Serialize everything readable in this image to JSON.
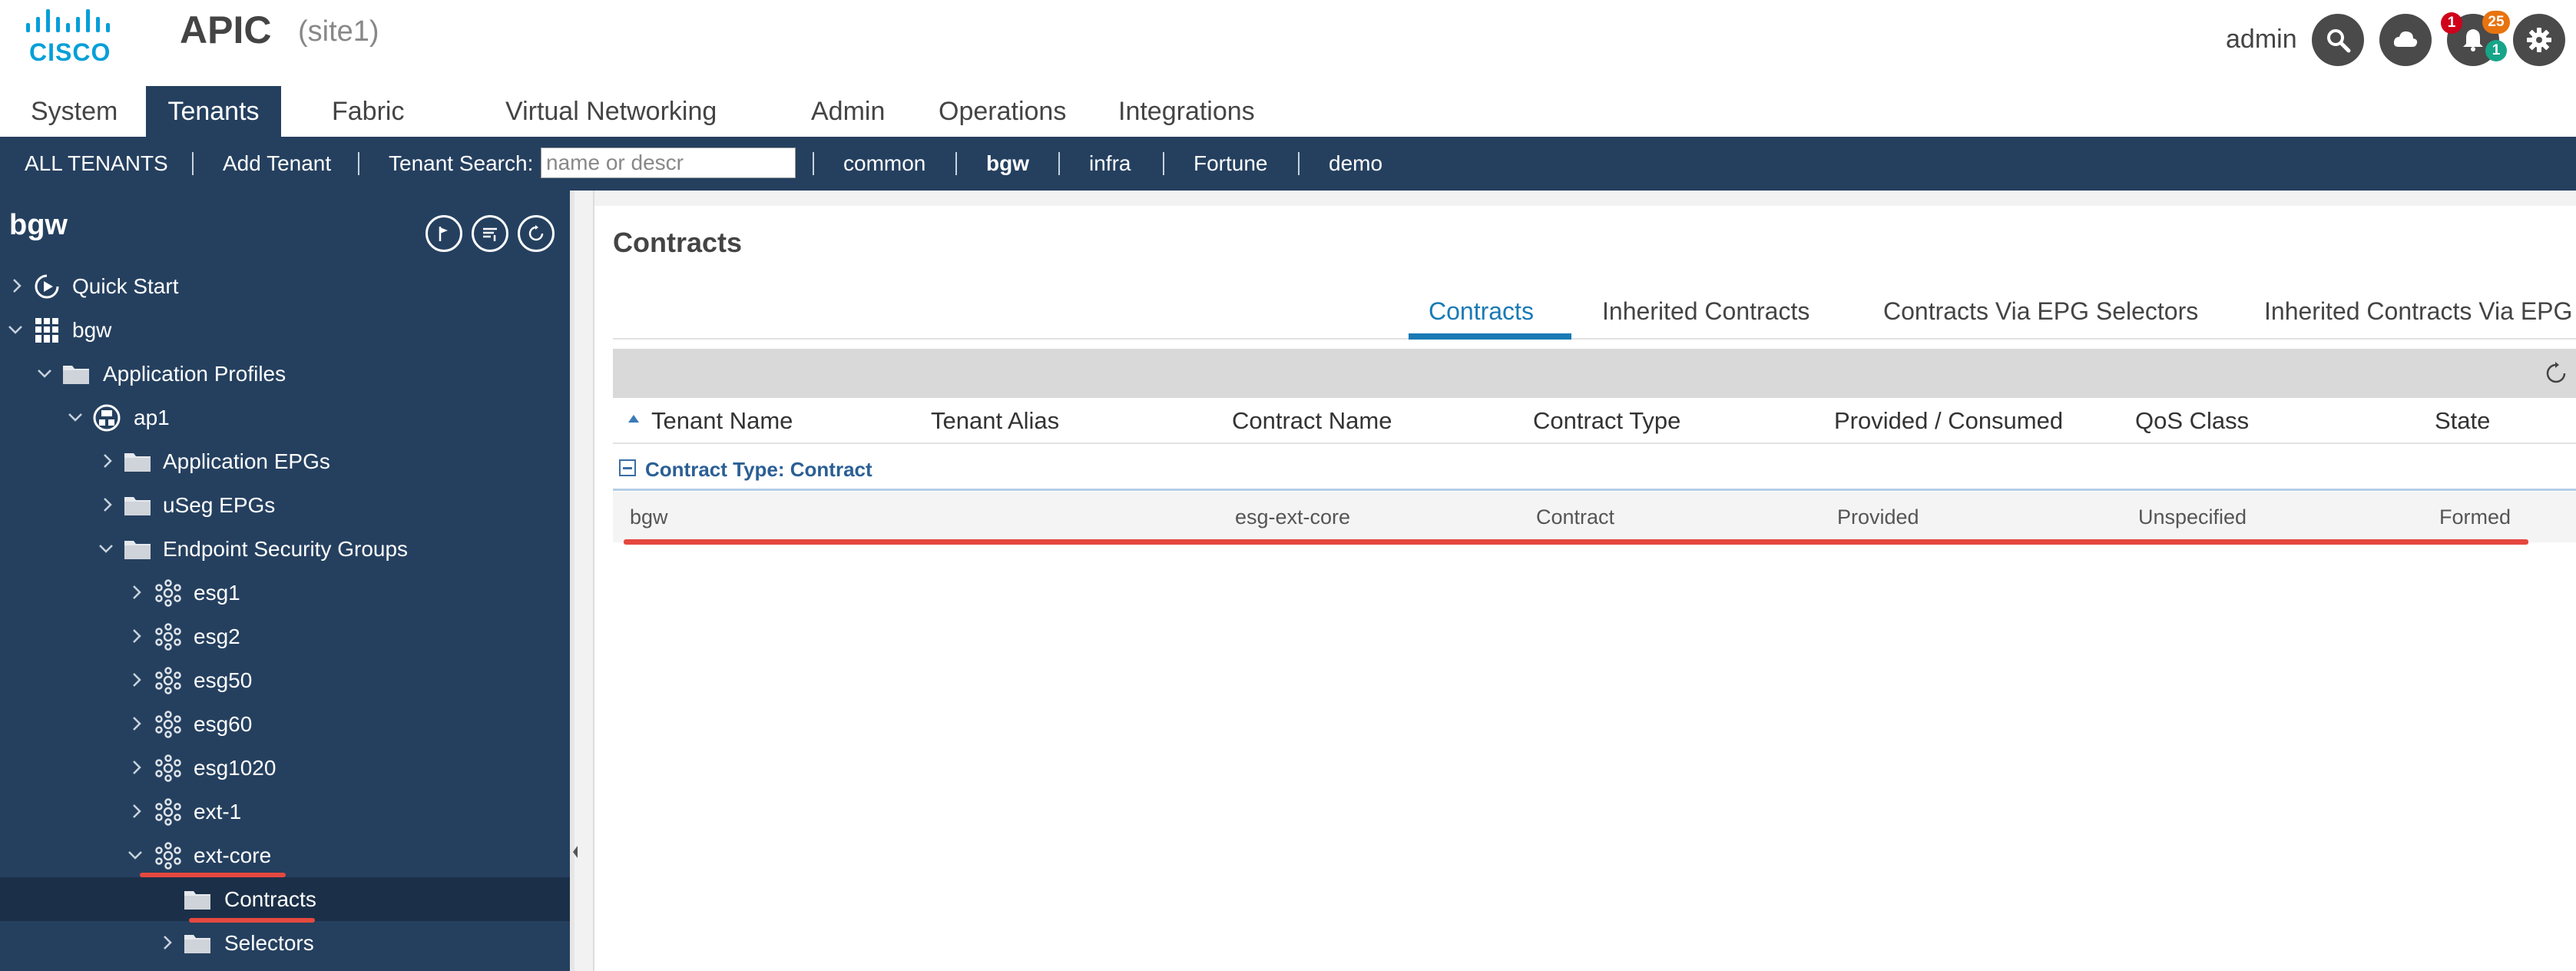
{
  "header": {
    "logo_text": "CISCO",
    "app_title": "APIC",
    "site": "(site1)",
    "user": "admin",
    "icons": [
      "search-icon",
      "cloud-icon",
      "bell-icon",
      "gear-icon"
    ],
    "badges": {
      "critical": "1",
      "warning": "25",
      "info": "1"
    }
  },
  "main_nav": {
    "tabs": [
      {
        "label": "System"
      },
      {
        "label": "Tenants"
      },
      {
        "label": "Fabric"
      },
      {
        "label": "Virtual Networking"
      },
      {
        "label": "Admin"
      },
      {
        "label": "Operations"
      },
      {
        "label": "Integrations"
      }
    ],
    "active": "Tenants"
  },
  "sub_nav": {
    "all_tenants": "ALL TENANTS",
    "add_tenant": "Add Tenant",
    "search_label": "Tenant Search:",
    "search_placeholder": "name or descr",
    "tenants": [
      "common",
      "bgw",
      "infra",
      "Fortune",
      "demo"
    ],
    "active_tenant": "bgw"
  },
  "sidebar": {
    "title": "bgw",
    "tree": [
      {
        "label": "Quick Start",
        "icon": "quick-start-icon"
      },
      {
        "label": "bgw",
        "icon": "tenant-grid-icon"
      },
      {
        "label": "Application Profiles",
        "icon": "folder-icon"
      },
      {
        "label": "ap1",
        "icon": "app-profile-icon"
      },
      {
        "label": "Application EPGs",
        "icon": "folder-icon"
      },
      {
        "label": "uSeg EPGs",
        "icon": "folder-icon"
      },
      {
        "label": "Endpoint Security Groups",
        "icon": "folder-icon"
      },
      {
        "label": "esg1",
        "icon": "esg-icon"
      },
      {
        "label": "esg2",
        "icon": "esg-icon"
      },
      {
        "label": "esg50",
        "icon": "esg-icon"
      },
      {
        "label": "esg60",
        "icon": "esg-icon"
      },
      {
        "label": "esg1020",
        "icon": "esg-icon"
      },
      {
        "label": "ext-1",
        "icon": "esg-icon"
      },
      {
        "label": "ext-core",
        "icon": "esg-icon"
      },
      {
        "label": "Contracts",
        "icon": "folder-icon"
      },
      {
        "label": "Selectors",
        "icon": "folder-icon"
      }
    ],
    "selected": "Contracts"
  },
  "content": {
    "title": "Contracts",
    "tabs": [
      {
        "label": "Contracts"
      },
      {
        "label": "Inherited Contracts"
      },
      {
        "label": "Contracts Via EPG Selectors"
      },
      {
        "label": "Inherited Contracts Via EPG"
      }
    ],
    "active_tab": "Contracts",
    "table": {
      "columns": [
        "Tenant Name",
        "Tenant Alias",
        "Contract Name",
        "Contract Type",
        "Provided / Consumed",
        "QoS Class",
        "State"
      ],
      "group_label": "Contract Type: Contract",
      "rows": [
        [
          "bgw",
          "",
          "esg-ext-core",
          "Contract",
          "Provided",
          "Unspecified",
          "Formed"
        ]
      ]
    }
  },
  "colors": {
    "nav_bg": "#25405f",
    "accent_blue": "#1a7ab5",
    "highlight_red": "#e5483f",
    "cisco_blue": "#049fd9"
  }
}
